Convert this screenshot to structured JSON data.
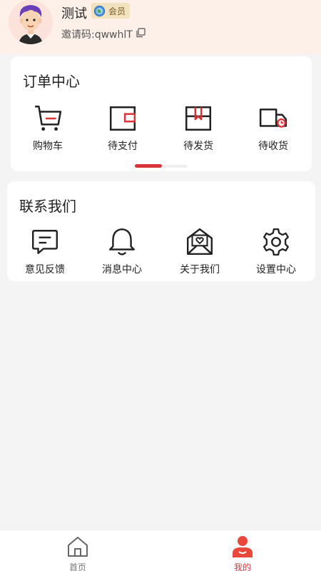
{
  "profile": {
    "name": "测试",
    "member_label": "会员",
    "invite_code": "邀请码:qwwhlT"
  },
  "orders": {
    "title": "订单中心",
    "items": [
      {
        "label": "购物车",
        "icon": "cart-icon"
      },
      {
        "label": "待支付",
        "icon": "wallet-icon"
      },
      {
        "label": "待发货",
        "icon": "package-icon"
      },
      {
        "label": "待收货",
        "icon": "truck-icon"
      }
    ]
  },
  "contact": {
    "title": "联系我们",
    "items": [
      {
        "label": "意见反馈",
        "icon": "feedback-icon"
      },
      {
        "label": "消息中心",
        "icon": "bell-icon"
      },
      {
        "label": "关于我们",
        "icon": "heart-mail-icon"
      },
      {
        "label": "设置中心",
        "icon": "gear-icon"
      }
    ]
  },
  "tabbar": {
    "home": "首页",
    "mine": "我的"
  },
  "colors": {
    "accent": "#d9343a",
    "header_bg": "#fdf0e8",
    "page_bg": "#f4f4f4"
  }
}
